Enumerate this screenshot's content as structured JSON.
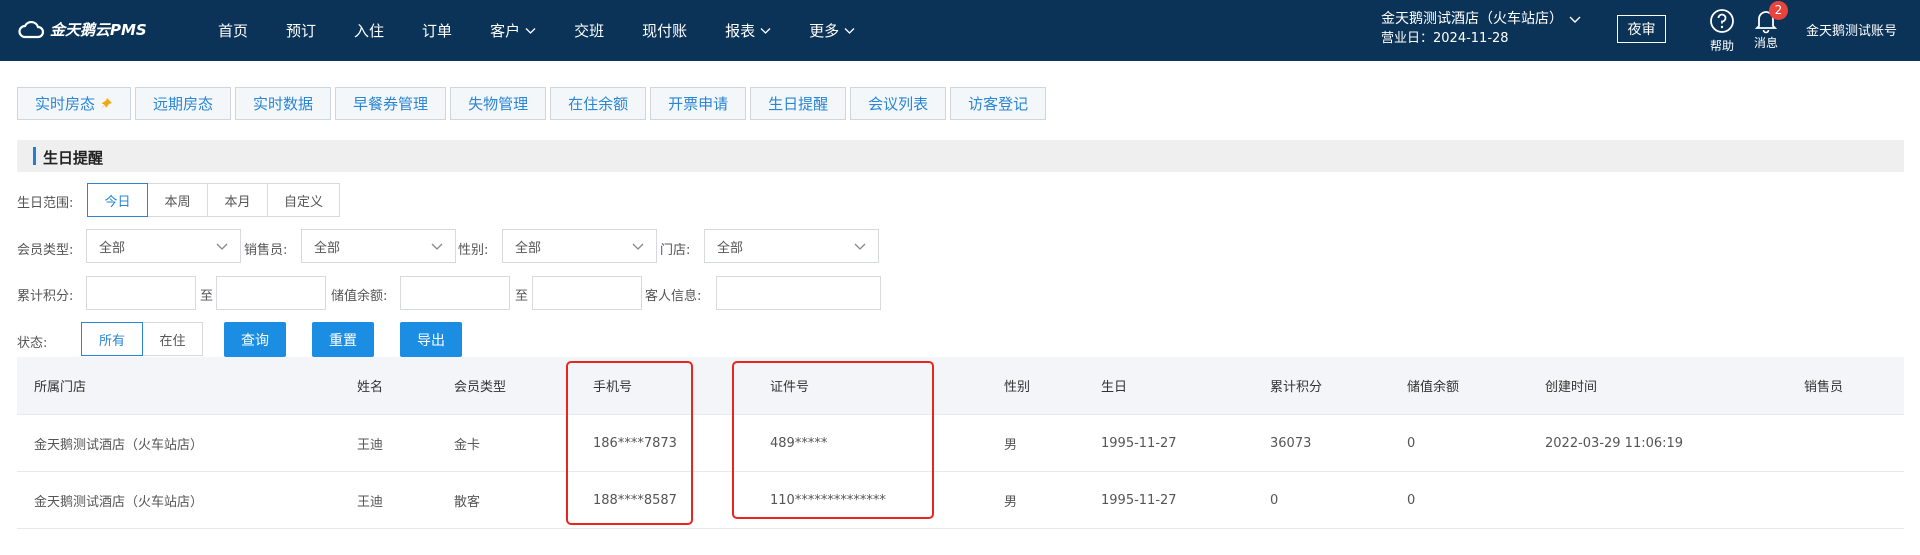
{
  "topbar": {
    "logo_text": "金天鹅云PMS",
    "nav": [
      {
        "label": "首页",
        "has_caret": false
      },
      {
        "label": "预订",
        "has_caret": false
      },
      {
        "label": "入住",
        "has_caret": false
      },
      {
        "label": "订单",
        "has_caret": false
      },
      {
        "label": "客户",
        "has_caret": true
      },
      {
        "label": "交班",
        "has_caret": false
      },
      {
        "label": "现付账",
        "has_caret": false
      },
      {
        "label": "报表",
        "has_caret": true
      },
      {
        "label": "更多",
        "has_caret": true
      }
    ],
    "hotel_name": "金天鹅测试酒店（火车站店）",
    "business_day": "营业日：2024-11-28",
    "night_audit": "夜审",
    "help_label": "帮助",
    "message_label": "消息",
    "message_count": "2",
    "account": "金天鹅测试账号"
  },
  "tabs": [
    "实时房态",
    "远期房态",
    "实时数据",
    "早餐券管理",
    "失物管理",
    "在住余额",
    "开票申请",
    "生日提醒",
    "会议列表",
    "访客登记"
  ],
  "section_title": "生日提醒",
  "filters": {
    "range_label": "生日范围:",
    "range_options": [
      "今日",
      "本周",
      "本月",
      "自定义"
    ],
    "range_selected": 0,
    "member_type_label": "会员类型:",
    "member_type_value": "全部",
    "salesperson_label": "销售员:",
    "salesperson_value": "全部",
    "gender_label": "性别:",
    "gender_value": "全部",
    "store_label": "门店:",
    "store_value": "全部",
    "points_label": "累计积分:",
    "to_label": "至",
    "balance_label": "储值余额:",
    "guest_info_label": "客人信息:",
    "status_label": "状态:",
    "status_options": [
      "所有",
      "在住"
    ],
    "status_selected": 0,
    "query_button": "查询",
    "reset_button": "重置",
    "export_button": "导出"
  },
  "table": {
    "columns": [
      "所属门店",
      "姓名",
      "会员类型",
      "手机号",
      "证件号",
      "性别",
      "生日",
      "累计积分",
      "储值余额",
      "创建时间",
      "销售员"
    ],
    "rows": [
      [
        "金天鹅测试酒店（火车站店）",
        "王迪",
        "金卡",
        "186****7873",
        "489*****",
        "男",
        "1995-11-27",
        "36073",
        "0",
        "2022-03-29 11:06:19",
        ""
      ],
      [
        "金天鹅测试酒店（火车站店）",
        "王迪",
        "散客",
        "188****8587",
        "110**************",
        "男",
        "1995-11-27",
        "0",
        "0",
        "",
        ""
      ]
    ]
  },
  "colors": {
    "topbar_bg": "#0b3357",
    "accent": "#1b8ee3",
    "highlight": "#e8261f",
    "badge": "#e8433c"
  }
}
